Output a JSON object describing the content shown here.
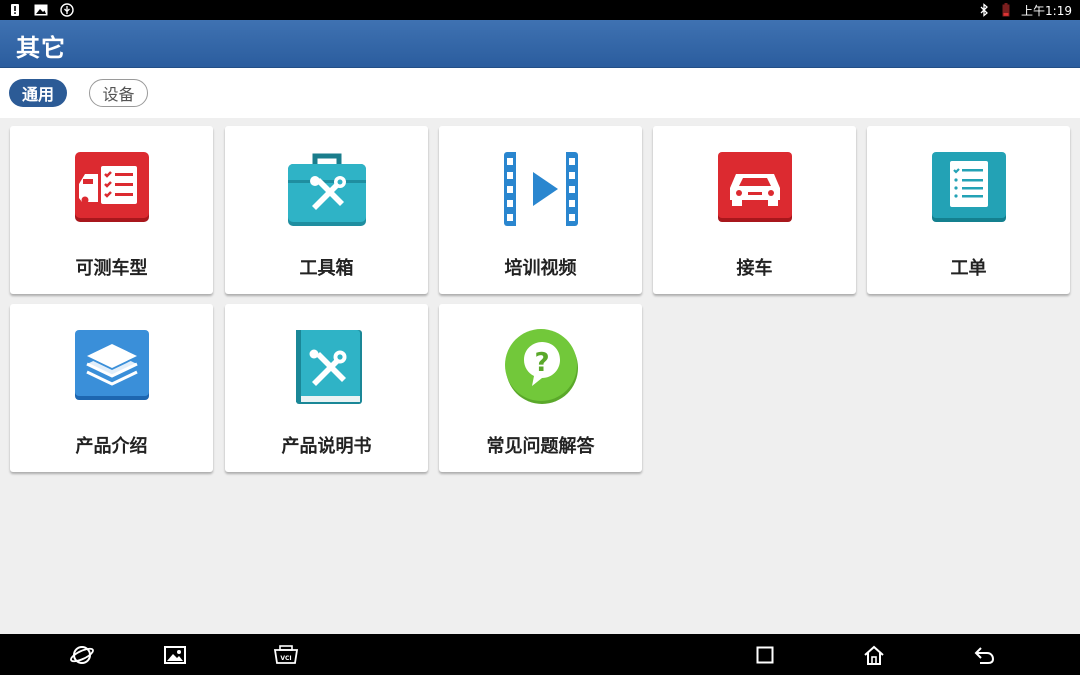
{
  "status_bar": {
    "left_icons": [
      "battery-alert-icon",
      "image-notification-icon",
      "usb-icon"
    ],
    "right_icons": [
      "bluetooth-icon",
      "battery-icon"
    ],
    "time": "上午1:19"
  },
  "header": {
    "title": "其它"
  },
  "tabs": [
    {
      "label": "通用",
      "selected": true
    },
    {
      "label": "设备",
      "selected": false
    }
  ],
  "tiles": [
    {
      "label": "可测车型",
      "icon": "vehicle-list-icon",
      "color": "#d8232a"
    },
    {
      "label": "工具箱",
      "icon": "toolbox-icon",
      "color": "#2aa6b8"
    },
    {
      "label": "培训视频",
      "icon": "video-play-icon",
      "color": "#2b8fd6"
    },
    {
      "label": "接车",
      "icon": "car-front-icon",
      "color": "#d8232a"
    },
    {
      "label": "工单",
      "icon": "work-order-list-icon",
      "color": "#23a2b5"
    },
    {
      "label": "产品介绍",
      "icon": "layers-icon",
      "color": "#3a8fd9"
    },
    {
      "label": "产品说明书",
      "icon": "manual-book-icon",
      "color": "#2aa6b8"
    },
    {
      "label": "常见问题解答",
      "icon": "faq-question-icon",
      "color": "#6cc334"
    }
  ],
  "nav_bar": {
    "left": [
      "browser-icon",
      "gallery-icon",
      "vci-icon"
    ],
    "right": [
      "recent-apps-icon",
      "home-icon",
      "back-icon"
    ]
  }
}
